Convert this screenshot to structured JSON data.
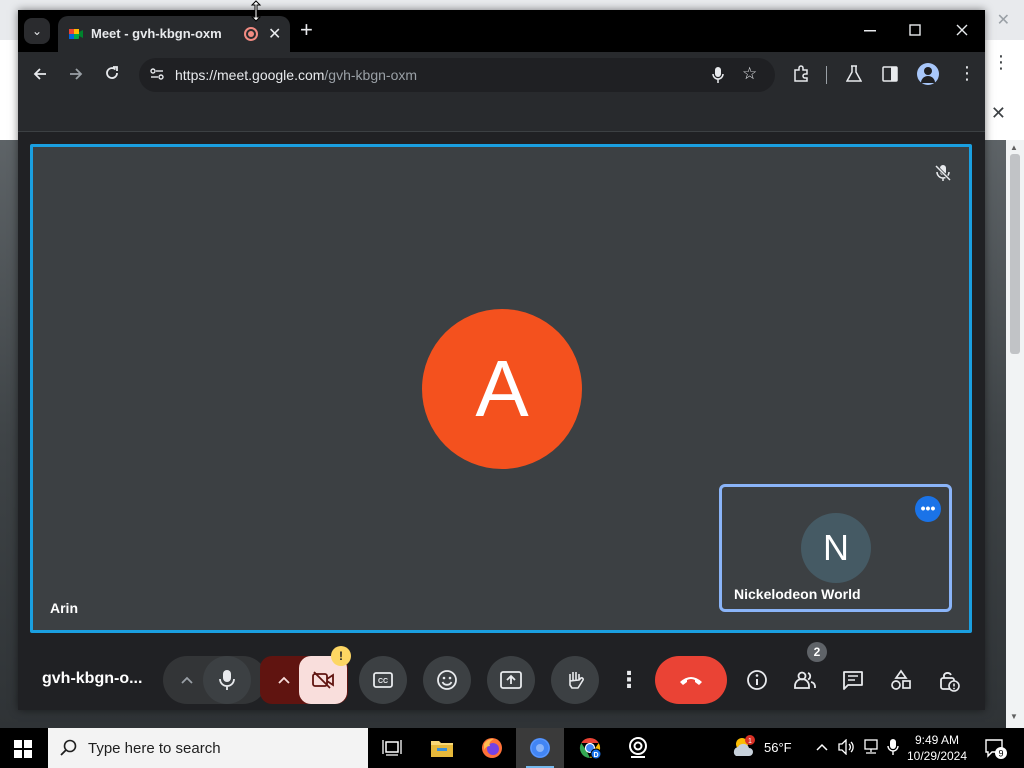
{
  "browser": {
    "tab_title": "Meet - gvh-kbgn-oxm",
    "url_host": "https://meet.google.com",
    "url_path": "/gvh-kbgn-oxm",
    "new_tab_label": "+",
    "tab_close": "✕"
  },
  "meet": {
    "main_participant": {
      "initial": "A",
      "name": "Arin",
      "avatar_color": "#f4511e"
    },
    "self_view": {
      "initial": "N",
      "name": "Nickelodeon World",
      "avatar_color": "#455a64"
    },
    "meeting_code": "gvh-kbgn-o...",
    "camera_warning": "!",
    "participant_count": "2",
    "more_options": "•••"
  },
  "taskbar": {
    "search_placeholder": "Type here to search",
    "weather_temp": "56°F",
    "weather_badge": "1",
    "time": "9:49 AM",
    "date": "10/29/2024",
    "notification_count": "9"
  },
  "colors": {
    "active_tile_border": "#1a9fe0",
    "self_tile_border": "#8ab4f8",
    "end_call": "#ea4335",
    "camera_off_bg": "#f9dedc"
  }
}
